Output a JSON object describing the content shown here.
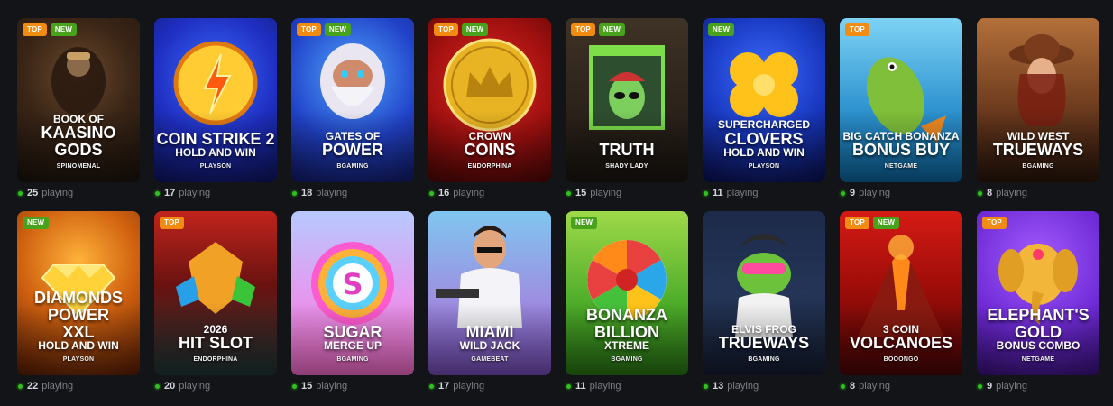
{
  "games": [
    {
      "id": "book-of-kaasino-gods",
      "badges": [
        "TOP",
        "NEW"
      ],
      "title_lines": [
        {
          "t": "BOOK OF",
          "s": "small"
        },
        {
          "t": "KAASINO",
          "s": "big"
        },
        {
          "t": "GODS",
          "s": "big"
        }
      ],
      "provider": "SPINOMENAL",
      "players": "25",
      "players_label": "playing",
      "bg": "radial-gradient(circle at 50% 35%, #6b4a2c 0%, #3a2516 45%, #1a120c 100%)",
      "icon": "warrior-icon"
    },
    {
      "id": "coin-strike-2",
      "badges": [],
      "title_lines": [
        {
          "t": "COIN STRIKE 2",
          "s": "big"
        },
        {
          "t": "HOLD AND WIN",
          "s": "small"
        }
      ],
      "provider": "PLAYSON",
      "players": "17",
      "players_label": "playing",
      "bg": "radial-gradient(circle at 50% 35%, #3a6cff 0%, #1f2fc2 50%, #0e1460 100%)",
      "icon": "lightning-coin-icon"
    },
    {
      "id": "gates-of-power",
      "badges": [
        "TOP",
        "NEW"
      ],
      "title_lines": [
        {
          "t": "GATES OF",
          "s": "small"
        },
        {
          "t": "POWER",
          "s": "big"
        }
      ],
      "provider": "BGAMING",
      "players": "18",
      "players_label": "playing",
      "bg": "radial-gradient(circle at 50% 35%, #4fa6ff 0%, #2142c8 55%, #121a6a 100%)",
      "icon": "zeus-icon"
    },
    {
      "id": "crown-coins",
      "badges": [
        "TOP",
        "NEW"
      ],
      "title_lines": [
        {
          "t": "CROWN",
          "s": "small"
        },
        {
          "t": "COINS",
          "s": "big"
        }
      ],
      "provider": "ENDORPHINA",
      "players": "16",
      "players_label": "playing",
      "bg": "radial-gradient(circle at 50% 40%, #e02a24 0%, #a0100f 55%, #4e0606 100%)",
      "icon": "crown-coin-icon"
    },
    {
      "id": "truth",
      "badges": [
        "TOP",
        "NEW"
      ],
      "title_lines": [
        {
          "t": "TRUTH",
          "s": "big"
        }
      ],
      "provider": "SHADY LADY",
      "players": "15",
      "players_label": "playing",
      "bg": "linear-gradient(180deg, #3f3226 0%, #2a2119 60%, #1a1510 100%)",
      "icon": "alien-icon"
    },
    {
      "id": "supercharged-clovers",
      "badges": [
        "NEW"
      ],
      "title_lines": [
        {
          "t": "SUPERCHARGED",
          "s": "small"
        },
        {
          "t": "CLOVERS",
          "s": "big"
        },
        {
          "t": "HOLD AND WIN",
          "s": "small"
        }
      ],
      "provider": "PLAYSON",
      "players": "11",
      "players_label": "playing",
      "bg": "radial-gradient(circle at 50% 35%, #3b6cff 0%, #1938c0 50%, #0a1050 100%)",
      "icon": "clover-icon"
    },
    {
      "id": "big-catch-bonanza",
      "badges": [
        "TOP"
      ],
      "title_lines": [
        {
          "t": "BIG CATCH BONANZA",
          "s": "small"
        },
        {
          "t": "BONUS BUY",
          "s": "big"
        }
      ],
      "provider": "NETGAME",
      "players": "9",
      "players_label": "playing",
      "bg": "linear-gradient(180deg, #7ed3f5 0%, #2f94d0 55%, #0d6aa6 100%)",
      "icon": "fish-icon"
    },
    {
      "id": "wild-west-trueways",
      "badges": [],
      "title_lines": [
        {
          "t": "WILD WEST",
          "s": "small"
        },
        {
          "t": "TRUEWAYS",
          "s": "big"
        }
      ],
      "provider": "BGAMING",
      "players": "8",
      "players_label": "playing",
      "bg": "linear-gradient(180deg, #b4703a 0%, #6d3b1e 55%, #2b160c 100%)",
      "icon": "cowgirl-icon"
    },
    {
      "id": "diamonds-power-xxl",
      "badges": [
        "NEW"
      ],
      "title_lines": [
        {
          "t": "DIAMONDS",
          "s": "big"
        },
        {
          "t": "POWER",
          "s": "big"
        },
        {
          "t": "XXL",
          "s": "big"
        },
        {
          "t": "HOLD AND WIN",
          "s": "small"
        }
      ],
      "provider": "PLAYSON",
      "players": "22",
      "players_label": "playing",
      "bg": "radial-gradient(circle at 50% 30%, #ffb23a 0%, #d0610f 45%, #5a1c05 100%)",
      "icon": "diamond-icon"
    },
    {
      "id": "2026-hit-slot",
      "badges": [
        "TOP"
      ],
      "title_lines": [
        {
          "t": "2026",
          "s": "small"
        },
        {
          "t": "HIT SLOT",
          "s": "big"
        }
      ],
      "provider": "ENDORPHINA",
      "players": "20",
      "players_label": "playing",
      "bg": "linear-gradient(180deg, #c0241c 0%, #6a1210 45%, #1e3836 100%)",
      "icon": "gems-icon"
    },
    {
      "id": "sugar-merge-up",
      "badges": [],
      "title_lines": [
        {
          "t": "SUGAR",
          "s": "big"
        },
        {
          "t": "MERGE UP",
          "s": "small"
        }
      ],
      "provider": "BGAMING",
      "players": "15",
      "players_label": "playing",
      "bg": "linear-gradient(180deg, #b7c9ff 0%, #e29bf0 50%, #ff6fd2 100%)",
      "icon": "candy-s-icon"
    },
    {
      "id": "miami-wild-jack",
      "badges": [],
      "title_lines": [
        {
          "t": "MIAMI",
          "s": "big"
        },
        {
          "t": "WILD JACK",
          "s": "small"
        }
      ],
      "provider": "GAMEBEAT",
      "players": "17",
      "players_label": "playing",
      "bg": "linear-gradient(180deg, #7fc6f0 0%, #9d8ee0 55%, #7a4fc0 100%)",
      "icon": "gangster-icon"
    },
    {
      "id": "bonanza-billion-xtreme",
      "badges": [
        "NEW"
      ],
      "title_lines": [
        {
          "t": "BONANZA",
          "s": "big"
        },
        {
          "t": "BILLION",
          "s": "big"
        },
        {
          "t": "XTREME",
          "s": "small"
        }
      ],
      "provider": "BGAMING",
      "players": "11",
      "players_label": "playing",
      "bg": "linear-gradient(180deg, #9fd94a 0%, #4fae2a 55%, #2a7a16 100%)",
      "icon": "candy-wheel-icon"
    },
    {
      "id": "elvis-frog-trueways",
      "badges": [],
      "title_lines": [
        {
          "t": "ELVIS FROG",
          "s": "small"
        },
        {
          "t": "TRUEWAYS",
          "s": "big"
        }
      ],
      "provider": "BGAMING",
      "players": "13",
      "players_label": "playing",
      "bg": "linear-gradient(180deg, #1d2a4a 0%, #243557 50%, #151d33 100%)",
      "icon": "frog-icon"
    },
    {
      "id": "3-coin-volcanoes",
      "badges": [
        "TOP",
        "NEW"
      ],
      "title_lines": [
        {
          "t": "3 COIN",
          "s": "small"
        },
        {
          "t": "VOLCANOES",
          "s": "big"
        }
      ],
      "provider": "BOOONGO",
      "players": "8",
      "players_label": "playing",
      "bg": "linear-gradient(180deg, #d51a14 0%, #9a0c08 50%, #4a0505 100%)",
      "icon": "volcano-icon"
    },
    {
      "id": "elephants-gold",
      "badges": [
        "TOP"
      ],
      "title_lines": [
        {
          "t": "ELEPHANT'S",
          "s": "big"
        },
        {
          "t": "GOLD",
          "s": "big"
        },
        {
          "t": "BONUS COMBO",
          "s": "small"
        }
      ],
      "provider": "NETGAME",
      "players": "9",
      "players_label": "playing",
      "bg": "radial-gradient(circle at 50% 30%, #a45cff 0%, #6f2ad6 55%, #3a1180 100%)",
      "icon": "elephant-icon"
    }
  ]
}
